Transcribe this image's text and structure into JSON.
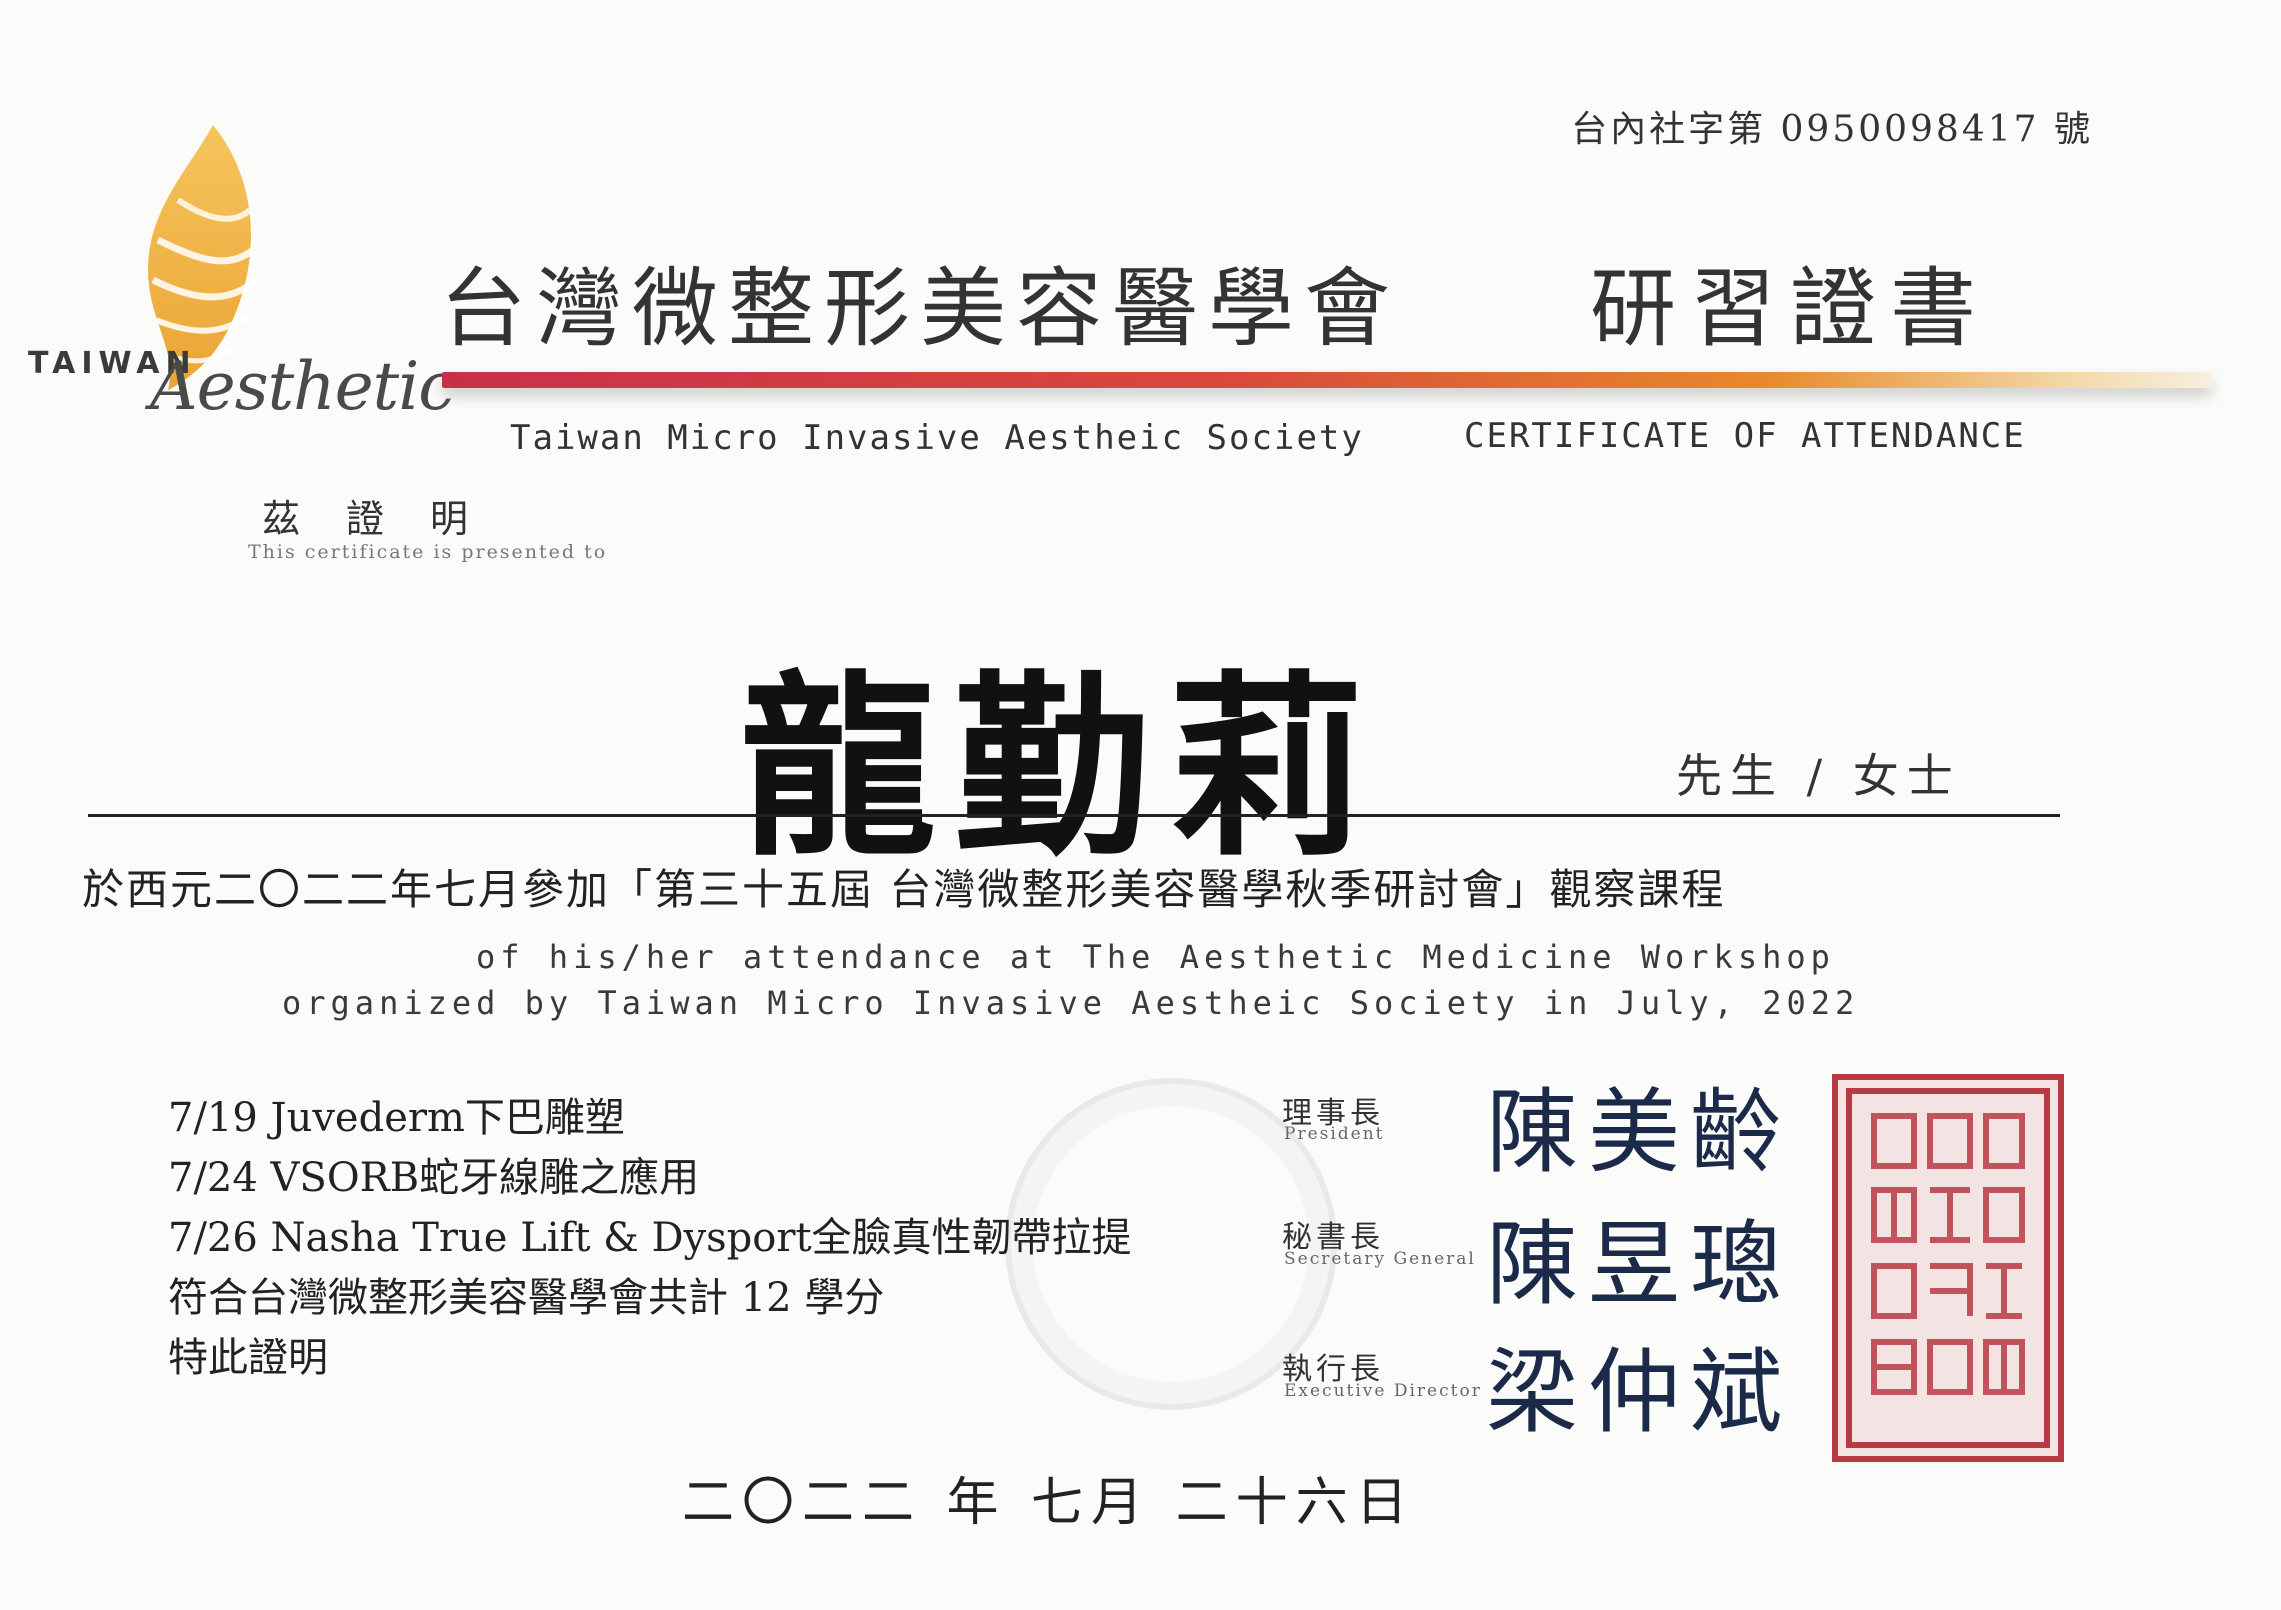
{
  "serial": "台內社字第 0950098417 號",
  "logo": {
    "word": "TAIWAN",
    "script": "Aesthetic",
    "flame_color": "#f0b13c"
  },
  "title": {
    "org_zh": "台灣微整形美容醫學會",
    "cert_zh": "研習證書",
    "org_en": "Taiwan Micro Invasive Aestheic Society",
    "cert_en": "CERTIFICATE OF ATTENDANCE"
  },
  "presented": {
    "zh": "茲證明",
    "en": "This certificate is presented to"
  },
  "recipient": {
    "name": "龍勤莉",
    "honorific": "先生 / 女士"
  },
  "body": {
    "zh": "於西元二〇二二年七月參加「第三十五屆 台灣微整形美容醫學秋季研討會」觀察課程",
    "en_line1": "of his/her attendance at The Aesthetic Medicine Workshop",
    "en_line2": "organized by Taiwan Micro Invasive Aestheic Society in July, 2022"
  },
  "courses": [
    "7/19 Juvederm下巴雕塑",
    "7/24 VSORB蛇牙線雕之應用",
    "7/26 Nasha True Lift & Dysport全臉真性韌帶拉提",
    "符合台灣微整形美容醫學會共計 12 學分",
    "特此證明"
  ],
  "signatories": [
    {
      "role_zh": "理事長",
      "role_en": "President",
      "name": "陳美齡"
    },
    {
      "role_zh": "秘書長",
      "role_en": "Secretary General",
      "name": "陳昱璁"
    },
    {
      "role_zh": "執行長",
      "role_en": "Executive Director",
      "name": "梁仲斌"
    }
  ],
  "seal_color": "#b73a44",
  "date": "二〇二二 年 七月 二十六日"
}
